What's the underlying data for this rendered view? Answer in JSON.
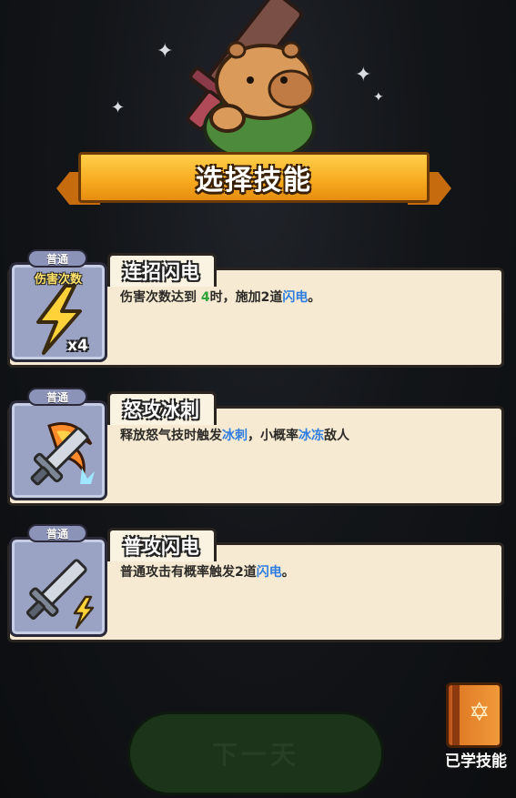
{
  "header": {
    "title": "选择技能"
  },
  "skills": [
    {
      "rarity": "普通",
      "name": "连招闪电",
      "icon": "lightning-bolt-icon",
      "icon_label": "伤害次数",
      "multiplier": "x4",
      "desc": {
        "p1": "伤害次数达到 ",
        "p2": "4",
        "p3": "时，施加2道",
        "p4": "闪电",
        "p5": "。"
      }
    },
    {
      "rarity": "普通",
      "name": "怒攻冰刺",
      "icon": "flaming-sword-icon",
      "desc": {
        "p1": "释放怒气技时触发",
        "p2": "冰刺",
        "p3": "，小概率",
        "p4": "冰冻",
        "p5": "敌人"
      }
    },
    {
      "rarity": "普通",
      "name": "普攻闪电",
      "icon": "sword-lightning-icon",
      "desc": {
        "p1": "普通攻击有概率触发2道",
        "p2": "闪电",
        "p3": "。"
      }
    }
  ],
  "footer": {
    "next_button": "下一天",
    "learned_skills": "已学技能"
  },
  "colors": {
    "highlight_blue": "#2f7de0",
    "highlight_green": "#2fa33a",
    "banner_gold": "#f7a91f",
    "card_bg": "#f6ead2"
  }
}
